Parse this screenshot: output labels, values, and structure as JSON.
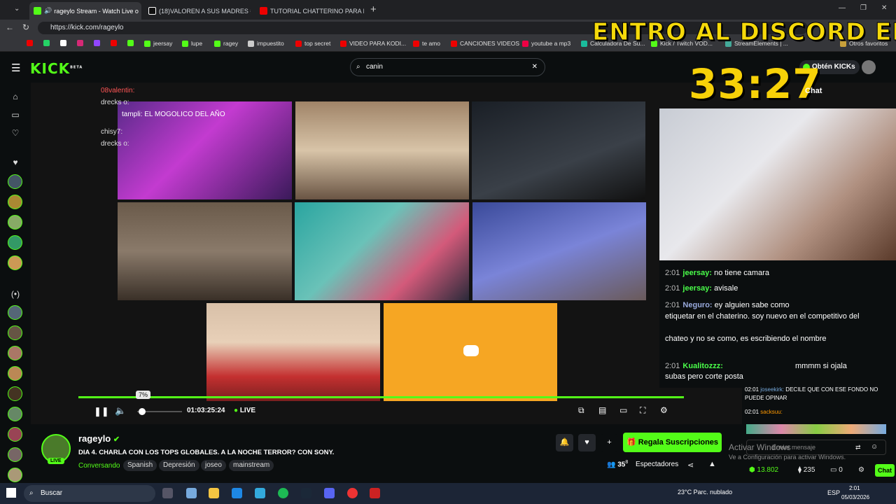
{
  "tabs": [
    {
      "label": "rageylo Stream - Watch Live o",
      "active": true
    },
    {
      "label": "(18)VALOREN A SUS MADRES #he"
    },
    {
      "label": "TUTORIAL CHATTERINO PARA KIC"
    }
  ],
  "address": {
    "url": "https://kick.com/rageylo"
  },
  "bookmarks": [
    "jeersay",
    "lupe",
    "ragey",
    "impuestito",
    "top secret",
    "VIDEO PARA KODI...",
    "te amo",
    "CANCIONES VIDEOS",
    "youtube a mp3",
    "Calculadora De Su...",
    "Kick / Twitch VOD...",
    "StreamElements | ...",
    "Otros favoritos"
  ],
  "kick": {
    "logo": "KICK",
    "logo_badge": "BETA",
    "search_value": "canin",
    "get_kicks": "Obtén KICKs"
  },
  "overlay": {
    "title": "ENTRO AL DISCORD EN",
    "timer": "33:27",
    "chat_label": "Chat"
  },
  "stream_chat_small": [
    {
      "user": "08valentin:",
      "msg": ""
    },
    {
      "user": "drecks o:",
      "msg": ""
    },
    {
      "user": "tampli",
      "msg": ": EL MOGOLICO DEL AÑO"
    },
    {
      "user": "chisy7:",
      "msg": ""
    },
    {
      "user": "drecks o:",
      "msg": ""
    }
  ],
  "stream_chat": [
    {
      "time": "2:01",
      "user": "jeersay:",
      "msg": "no tiene camara"
    },
    {
      "time": "2:01",
      "user": "jeersay:",
      "msg": "avisale"
    },
    {
      "time": "2:01",
      "user": "Neguro:",
      "msg": "ey alguien sabe como"
    },
    {
      "time": "",
      "user": "",
      "msg": "etiquetar en el chaterino. soy nuevo en el competitivo del"
    },
    {
      "time": "",
      "user": "",
      "msg": "chateo y no se como, es escribiendo el nombre"
    },
    {
      "time": "2:01",
      "user": "Kualitozzz:",
      "msg": "mmmm si ojala"
    },
    {
      "time": "",
      "user": "",
      "msg": "subas pero corte posta"
    }
  ],
  "player": {
    "volume_pct": "7%",
    "time": "01:03:25:24",
    "live": "LIVE"
  },
  "channel": {
    "name": "rageylo",
    "live_badge": "LIVE",
    "title": "DIA 4. CHARLA CON LOS TOPS GLOBALES. A LA NOCHE TERROR? CON SONY.",
    "category": "Conversando",
    "tags": [
      "Spanish",
      "Depresión",
      "joseo",
      "mainstream"
    ],
    "subscribe": "Regala Suscripciones",
    "viewers": "35",
    "viewers_sup": "8",
    "viewers_label": "Espectadores"
  },
  "right_chat": [
    {
      "time": "02:01",
      "user": "joseekirk:",
      "msg": "DECILE QUE CON ESE FONDO NO"
    },
    {
      "time": "",
      "user": "",
      "msg": "PUEDE OPINAR"
    },
    {
      "time": "02:01",
      "user": "sacksuu:",
      "msg": ""
    }
  ],
  "chat_input_placeholder": "Enviar mensaje",
  "windows_watermark": {
    "line1": "Activar Windows",
    "line2": "Ve a Configuración para activar Windows."
  },
  "chat_footer": {
    "kicks": "13.802",
    "count2": "235",
    "count3": "0",
    "chat_button": "Chat"
  },
  "taskbar": {
    "search": "Buscar",
    "weather": "23°C  Parc. nublado",
    "lang": "ESP",
    "time": "2:01",
    "date": "05/03/2026"
  },
  "colors": {
    "kick_green": "#53fc18",
    "timer_yellow": "#f7d108",
    "discord": "#f6a623"
  }
}
